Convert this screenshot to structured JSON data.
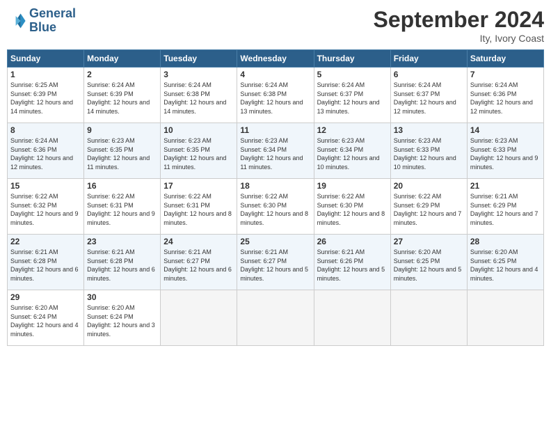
{
  "header": {
    "logo_line1": "General",
    "logo_line2": "Blue",
    "month": "September 2024",
    "location": "Ity, Ivory Coast"
  },
  "days_of_week": [
    "Sunday",
    "Monday",
    "Tuesday",
    "Wednesday",
    "Thursday",
    "Friday",
    "Saturday"
  ],
  "weeks": [
    [
      {
        "day": "1",
        "sunrise": "6:25 AM",
        "sunset": "6:39 PM",
        "daylight": "12 hours and 14 minutes."
      },
      {
        "day": "2",
        "sunrise": "6:24 AM",
        "sunset": "6:39 PM",
        "daylight": "12 hours and 14 minutes."
      },
      {
        "day": "3",
        "sunrise": "6:24 AM",
        "sunset": "6:38 PM",
        "daylight": "12 hours and 14 minutes."
      },
      {
        "day": "4",
        "sunrise": "6:24 AM",
        "sunset": "6:38 PM",
        "daylight": "12 hours and 13 minutes."
      },
      {
        "day": "5",
        "sunrise": "6:24 AM",
        "sunset": "6:37 PM",
        "daylight": "12 hours and 13 minutes."
      },
      {
        "day": "6",
        "sunrise": "6:24 AM",
        "sunset": "6:37 PM",
        "daylight": "12 hours and 12 minutes."
      },
      {
        "day": "7",
        "sunrise": "6:24 AM",
        "sunset": "6:36 PM",
        "daylight": "12 hours and 12 minutes."
      }
    ],
    [
      {
        "day": "8",
        "sunrise": "6:24 AM",
        "sunset": "6:36 PM",
        "daylight": "12 hours and 12 minutes."
      },
      {
        "day": "9",
        "sunrise": "6:23 AM",
        "sunset": "6:35 PM",
        "daylight": "12 hours and 11 minutes."
      },
      {
        "day": "10",
        "sunrise": "6:23 AM",
        "sunset": "6:35 PM",
        "daylight": "12 hours and 11 minutes."
      },
      {
        "day": "11",
        "sunrise": "6:23 AM",
        "sunset": "6:34 PM",
        "daylight": "12 hours and 11 minutes."
      },
      {
        "day": "12",
        "sunrise": "6:23 AM",
        "sunset": "6:34 PM",
        "daylight": "12 hours and 10 minutes."
      },
      {
        "day": "13",
        "sunrise": "6:23 AM",
        "sunset": "6:33 PM",
        "daylight": "12 hours and 10 minutes."
      },
      {
        "day": "14",
        "sunrise": "6:23 AM",
        "sunset": "6:33 PM",
        "daylight": "12 hours and 9 minutes."
      }
    ],
    [
      {
        "day": "15",
        "sunrise": "6:22 AM",
        "sunset": "6:32 PM",
        "daylight": "12 hours and 9 minutes."
      },
      {
        "day": "16",
        "sunrise": "6:22 AM",
        "sunset": "6:31 PM",
        "daylight": "12 hours and 9 minutes."
      },
      {
        "day": "17",
        "sunrise": "6:22 AM",
        "sunset": "6:31 PM",
        "daylight": "12 hours and 8 minutes."
      },
      {
        "day": "18",
        "sunrise": "6:22 AM",
        "sunset": "6:30 PM",
        "daylight": "12 hours and 8 minutes."
      },
      {
        "day": "19",
        "sunrise": "6:22 AM",
        "sunset": "6:30 PM",
        "daylight": "12 hours and 8 minutes."
      },
      {
        "day": "20",
        "sunrise": "6:22 AM",
        "sunset": "6:29 PM",
        "daylight": "12 hours and 7 minutes."
      },
      {
        "day": "21",
        "sunrise": "6:21 AM",
        "sunset": "6:29 PM",
        "daylight": "12 hours and 7 minutes."
      }
    ],
    [
      {
        "day": "22",
        "sunrise": "6:21 AM",
        "sunset": "6:28 PM",
        "daylight": "12 hours and 6 minutes."
      },
      {
        "day": "23",
        "sunrise": "6:21 AM",
        "sunset": "6:28 PM",
        "daylight": "12 hours and 6 minutes."
      },
      {
        "day": "24",
        "sunrise": "6:21 AM",
        "sunset": "6:27 PM",
        "daylight": "12 hours and 6 minutes."
      },
      {
        "day": "25",
        "sunrise": "6:21 AM",
        "sunset": "6:27 PM",
        "daylight": "12 hours and 5 minutes."
      },
      {
        "day": "26",
        "sunrise": "6:21 AM",
        "sunset": "6:26 PM",
        "daylight": "12 hours and 5 minutes."
      },
      {
        "day": "27",
        "sunrise": "6:20 AM",
        "sunset": "6:25 PM",
        "daylight": "12 hours and 5 minutes."
      },
      {
        "day": "28",
        "sunrise": "6:20 AM",
        "sunset": "6:25 PM",
        "daylight": "12 hours and 4 minutes."
      }
    ],
    [
      {
        "day": "29",
        "sunrise": "6:20 AM",
        "sunset": "6:24 PM",
        "daylight": "12 hours and 4 minutes."
      },
      {
        "day": "30",
        "sunrise": "6:20 AM",
        "sunset": "6:24 PM",
        "daylight": "12 hours and 3 minutes."
      },
      null,
      null,
      null,
      null,
      null
    ]
  ]
}
